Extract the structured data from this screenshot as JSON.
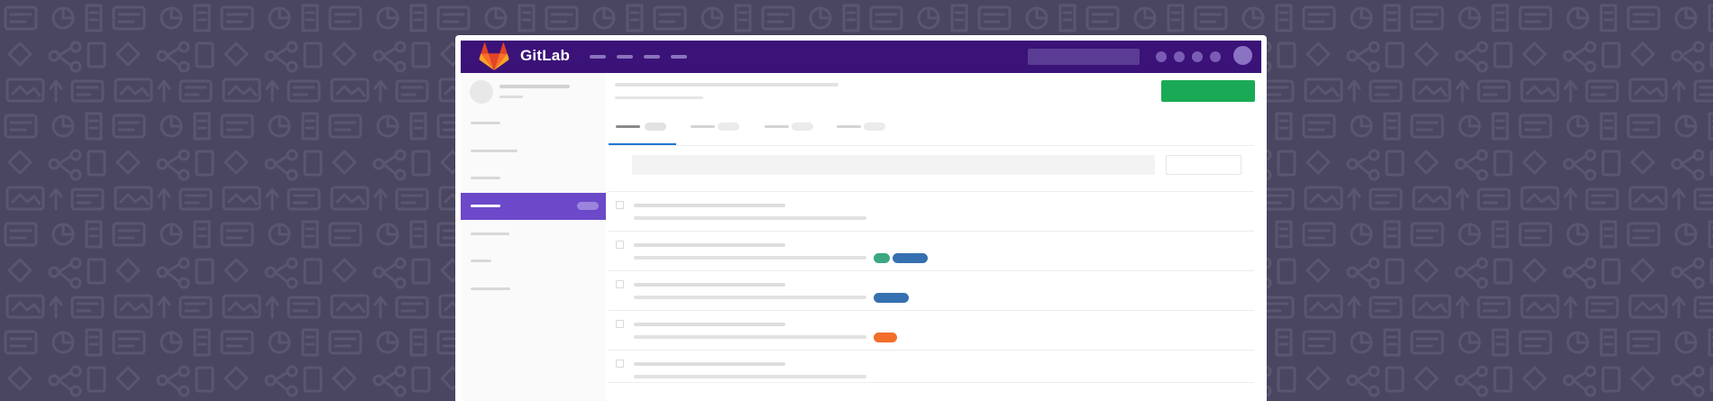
{
  "app": {
    "brand_name": "GitLab"
  },
  "colors": {
    "background": "#4a4560",
    "topbar": "#3b1278",
    "active_sidebar": "#6c49c9",
    "new_button": "#1aaa55",
    "active_tab_underline": "#1f78d1",
    "logo_orange": "#fc6d26",
    "logo_red": "#e24329",
    "logo_light": "#fca326"
  },
  "icons": {
    "logo": "gitlab-tanuki-logo",
    "user_avatar": "user-avatar-icon",
    "project_avatar": "project-avatar-icon"
  },
  "issues": {
    "labels": [
      [],
      [
        {
          "color": "#3ba882"
        },
        {
          "color": "#3570b0"
        }
      ],
      [
        {
          "color": "#3570b0"
        }
      ],
      [
        {
          "color": "#f26e2a"
        }
      ],
      []
    ]
  }
}
